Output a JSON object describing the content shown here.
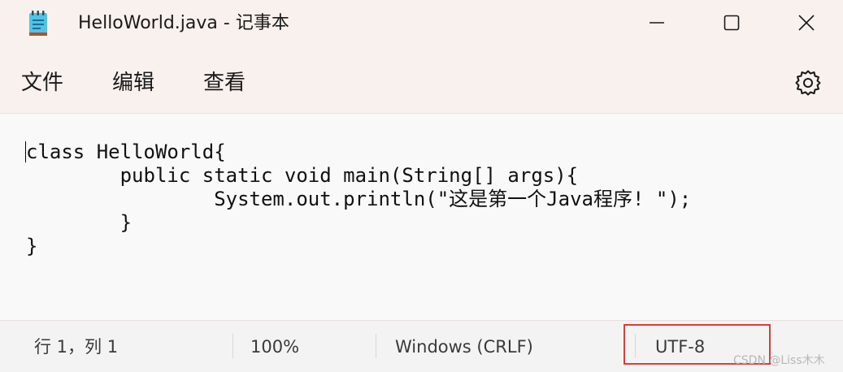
{
  "window": {
    "title": "HelloWorld.java - 记事本",
    "app_icon": "notepad-icon",
    "controls": [
      "minimize-icon",
      "maximize-icon",
      "close-icon"
    ]
  },
  "menu": {
    "file": "文件",
    "edit": "编辑",
    "view": "查看",
    "settings_icon": "gear-icon"
  },
  "editor": {
    "content": "class HelloWorld{\n        public static void main(String[] args){\n                System.out.println(\"这是第一个Java程序! \");\n        }\n}"
  },
  "statusbar": {
    "position": "行 1，列 1",
    "zoom": "100%",
    "line_ending": "Windows (CRLF)",
    "encoding": "UTF-8",
    "highlight_color": "#e03a3a"
  },
  "watermark": "CSDN @Liss木木"
}
